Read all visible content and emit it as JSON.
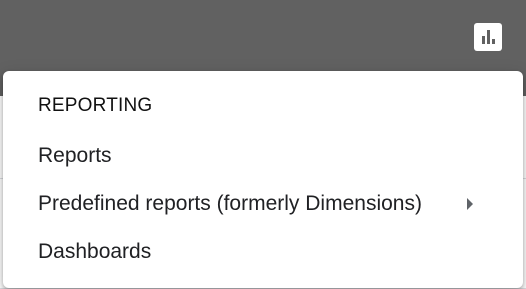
{
  "colors": {
    "topbar": "#616161",
    "menu_background": "#ffffff",
    "text": "#202124",
    "chevron": "#5f6368"
  },
  "toolbar": {
    "reports_icon": "bar-chart-icon"
  },
  "menu": {
    "heading": "REPORTING",
    "items": [
      {
        "label": "Reports",
        "has_submenu": false
      },
      {
        "label": "Predefined reports (formerly Dimensions)",
        "has_submenu": true,
        "submenu_icon": "chevron-right-icon"
      },
      {
        "label": "Dashboards",
        "has_submenu": false
      }
    ]
  }
}
